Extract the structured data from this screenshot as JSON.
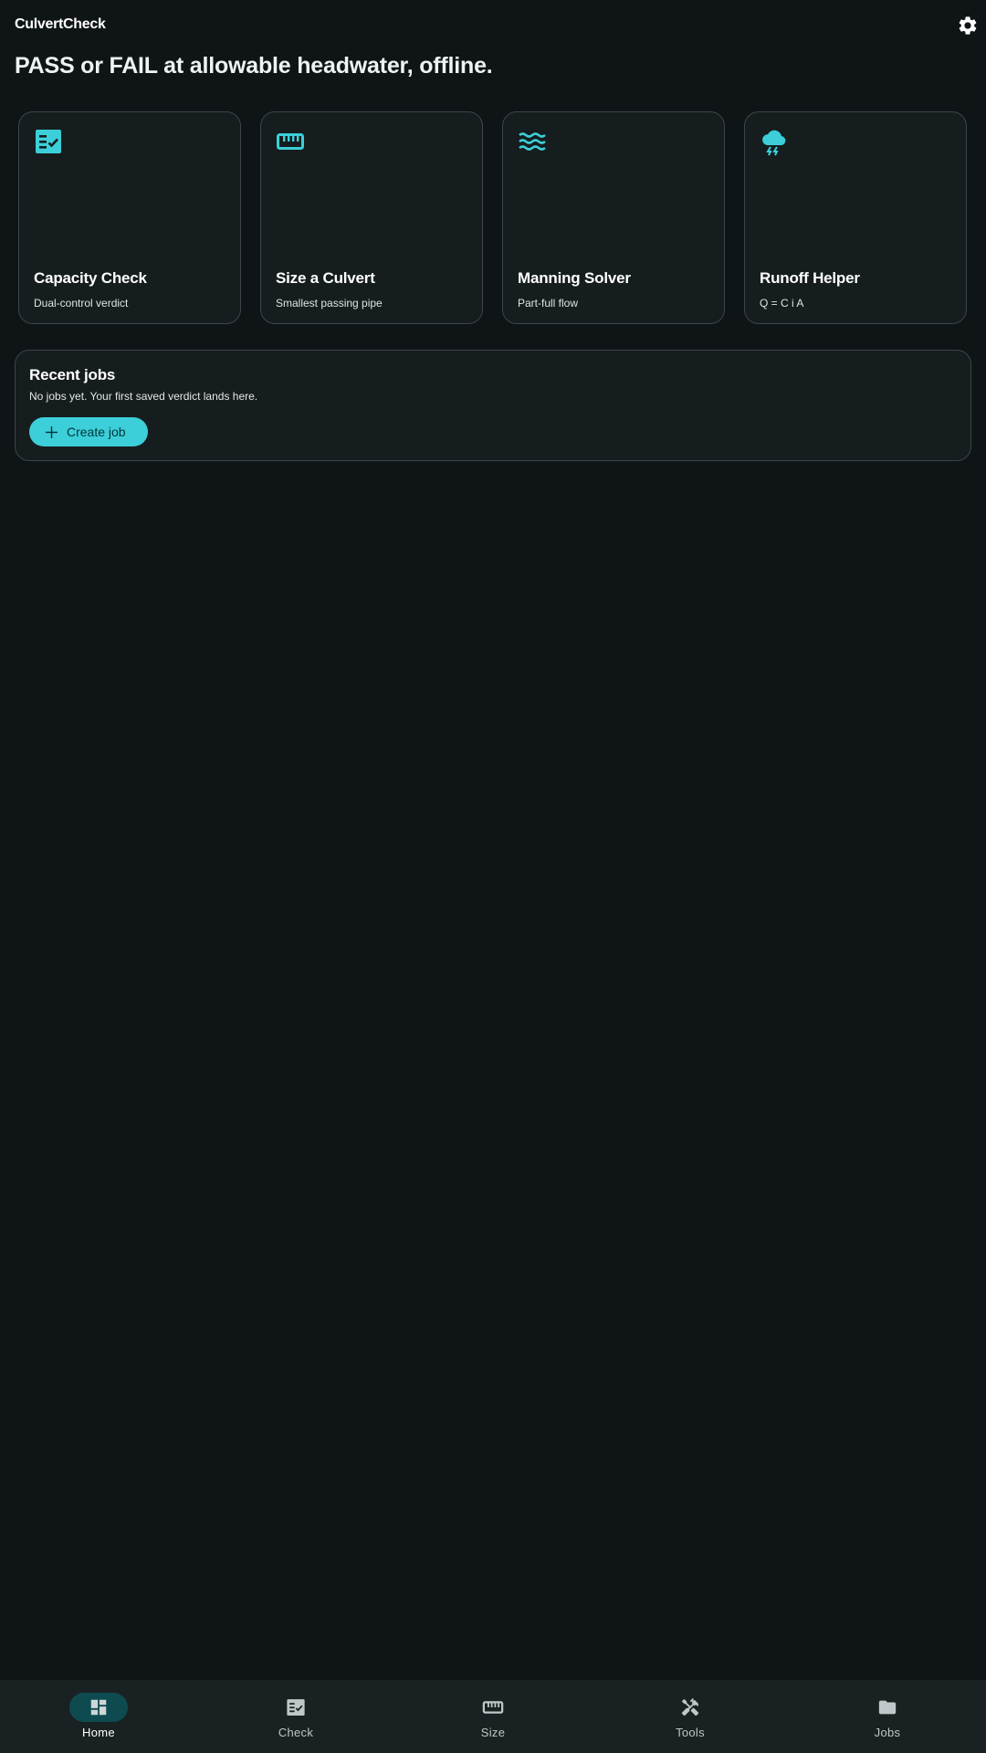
{
  "app": {
    "title": "CulvertCheck",
    "headline": "PASS or FAIL at allowable headwater, offline."
  },
  "colors": {
    "accent": "#3ccfd9",
    "background": "#0f1417",
    "surface": "#161d1e",
    "nav_active_pill": "#0e4b51"
  },
  "cards": [
    {
      "title": "Capacity Check",
      "subtitle": "Dual-control verdict",
      "icon": "fact-check-icon"
    },
    {
      "title": "Size a Culvert",
      "subtitle": "Smallest passing pipe",
      "icon": "ruler-icon"
    },
    {
      "title": "Manning Solver",
      "subtitle": "Part-full flow",
      "icon": "waves-icon"
    },
    {
      "title": "Runoff Helper",
      "subtitle": "Q = C i A",
      "icon": "storm-cloud-icon"
    }
  ],
  "recent_jobs": {
    "title": "Recent jobs",
    "empty_text": "No jobs yet. Your first saved verdict lands here.",
    "create_label": "Create job"
  },
  "nav": {
    "items": [
      {
        "label": "Home",
        "icon": "dashboard-icon",
        "active": true
      },
      {
        "label": "Check",
        "icon": "fact-check-icon",
        "active": false
      },
      {
        "label": "Size",
        "icon": "ruler-icon",
        "active": false
      },
      {
        "label": "Tools",
        "icon": "tools-icon",
        "active": false
      },
      {
        "label": "Jobs",
        "icon": "folder-icon",
        "active": false
      }
    ]
  }
}
